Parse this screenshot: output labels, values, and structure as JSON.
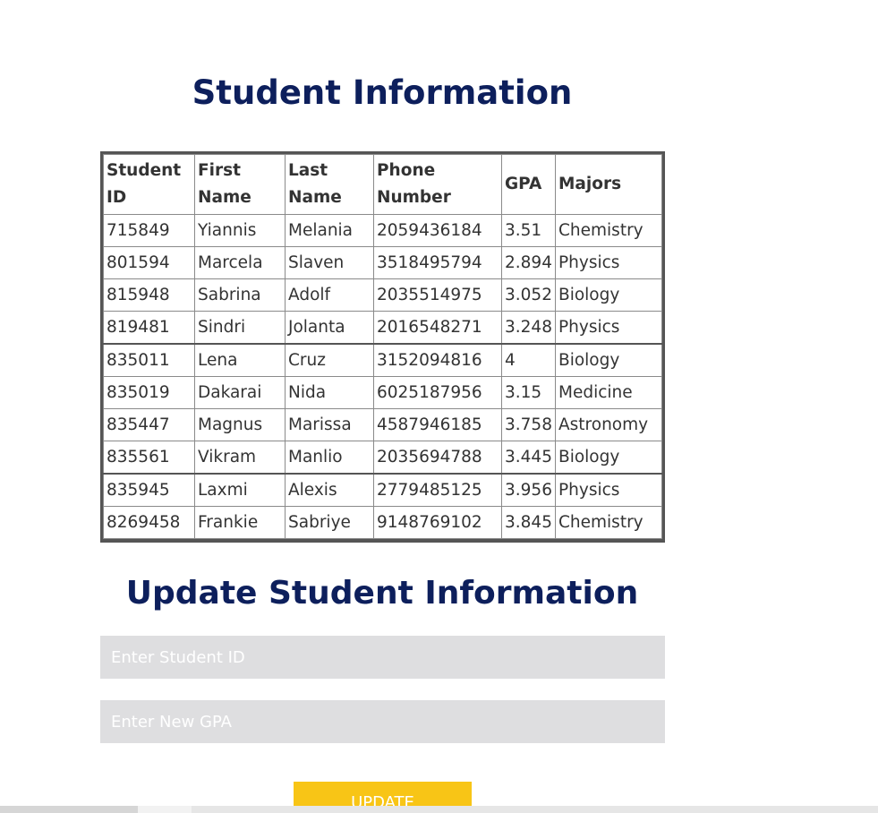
{
  "page": {
    "title": "Student Information",
    "update_title": "Update Student Information"
  },
  "table": {
    "headers": [
      "Student ID",
      "First Name",
      "Last Name",
      "Phone Number",
      "GPA",
      "Majors"
    ],
    "rows": [
      [
        "715849",
        "Yiannis",
        "Melania",
        "2059436184",
        "3.51",
        "Chemistry"
      ],
      [
        "801594",
        "Marcela",
        "Slaven",
        "3518495794",
        "2.894",
        "Physics"
      ],
      [
        "815948",
        "Sabrina",
        "Adolf",
        "2035514975",
        "3.052",
        "Biology"
      ],
      [
        "819481",
        "Sindri",
        "Jolanta",
        "2016548271",
        "3.248",
        "Physics"
      ],
      [
        "835011",
        "Lena",
        "Cruz",
        "3152094816",
        "4",
        "Biology"
      ],
      [
        "835019",
        "Dakarai",
        "Nida",
        "6025187956",
        "3.15",
        "Medicine"
      ],
      [
        "835447",
        "Magnus",
        "Marissa",
        "4587946185",
        "3.758",
        "Astronomy"
      ],
      [
        "835561",
        "Vikram",
        "Manlio",
        "2035694788",
        "3.445",
        "Biology"
      ],
      [
        "835945",
        "Laxmi",
        "Alexis",
        "2779485125",
        "3.956",
        "Physics"
      ],
      [
        "8269458",
        "Frankie",
        "Sabriye",
        "9148769102",
        "3.845",
        "Chemistry"
      ]
    ]
  },
  "form": {
    "student_id_placeholder": "Enter Student ID",
    "student_id_value": "",
    "gpa_placeholder": "Enter New GPA",
    "gpa_value": "",
    "update_label": "UPDATE"
  },
  "colors": {
    "heading": "#0d1f5c",
    "input_background": "#dedee0",
    "button": "#f8c516"
  }
}
